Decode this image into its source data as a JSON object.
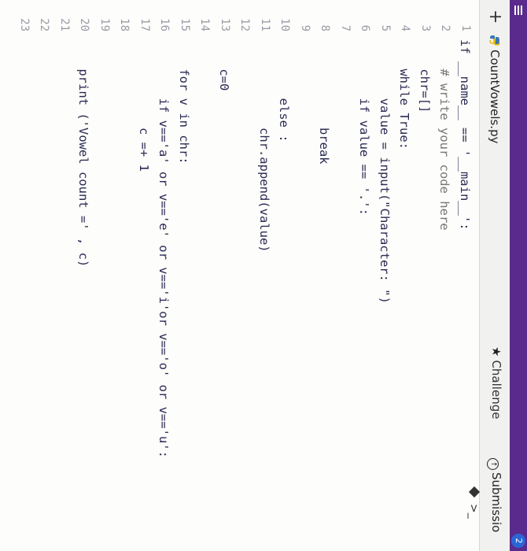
{
  "header": {
    "badge": "2",
    "tab_filename": "CountVowels.py",
    "challenge_label": "Challenge",
    "submission_label": "Submissio",
    "terminal_glyph": ">_"
  },
  "editor": {
    "lines": [
      {
        "n": "1",
        "t": "if __name__ == '__main__':"
      },
      {
        "n": "2",
        "t": "    # write your code here"
      },
      {
        "n": "3",
        "t": "    chr=[]"
      },
      {
        "n": "4",
        "t": "    while True:"
      },
      {
        "n": "5",
        "t": "        value = input(\"Character: \")"
      },
      {
        "n": "6",
        "t": "        if value == '.':"
      },
      {
        "n": "7",
        "t": ""
      },
      {
        "n": "8",
        "t": "            break"
      },
      {
        "n": "9",
        "t": ""
      },
      {
        "n": "10",
        "t": "        else :"
      },
      {
        "n": "11",
        "t": "            chr.append(value)"
      },
      {
        "n": "12",
        "t": ""
      },
      {
        "n": "13",
        "t": "    c=0"
      },
      {
        "n": "14",
        "t": ""
      },
      {
        "n": "15",
        "t": "    for v in chr:"
      },
      {
        "n": "16",
        "t": "        if v=='a' or v=='e' or v=='i'or v=='o' or v=='u':"
      },
      {
        "n": "17",
        "t": "            c =+ 1"
      },
      {
        "n": "18",
        "t": ""
      },
      {
        "n": "19",
        "t": ""
      },
      {
        "n": "20",
        "t": "    print ('Vowel count =' , c)"
      },
      {
        "n": "21",
        "t": ""
      },
      {
        "n": "22",
        "t": ""
      },
      {
        "n": "23",
        "t": ""
      }
    ]
  },
  "colors": {
    "topbar": "#5a2a8c",
    "keyword": "#5a2ea6",
    "string": "#b6246a",
    "text": "#2b2b55",
    "badge": "#2a66d6"
  },
  "icons": [
    "menu-icon",
    "plus-icon",
    "python-file-icon",
    "star-icon",
    "submission-icon",
    "run-icon",
    "terminal-icon"
  ]
}
